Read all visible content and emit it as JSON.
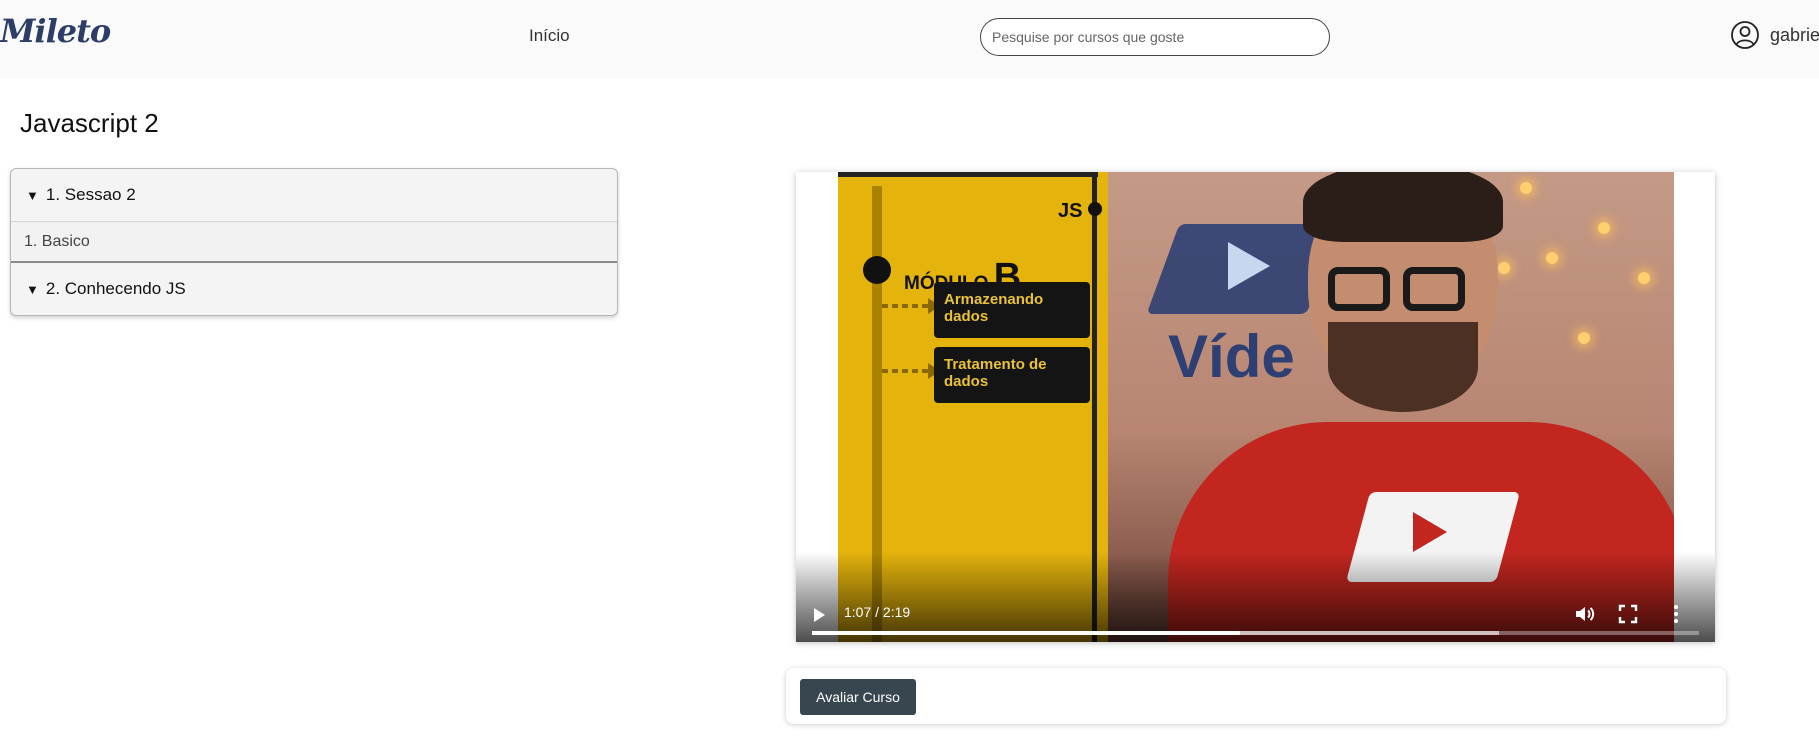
{
  "header": {
    "logo": "Mileto",
    "nav_inicio": "Início",
    "search_placeholder": "Pesquise por cursos que goste",
    "username": "gabriel",
    "user_icon": "user-circle-icon"
  },
  "course": {
    "title": "Javascript 2",
    "sections": [
      {
        "label": "1. Sessao 2",
        "lessons": [
          "1. Basico"
        ]
      },
      {
        "label": "2. Conhecendo JS",
        "lessons": []
      }
    ]
  },
  "video": {
    "slide_js": "JS",
    "slide_modulo": "MÓDULO",
    "slide_modulo_letter": "B",
    "slide_item_1": "Armazenando dados",
    "slide_item_2": "Tratamento de dados",
    "wall_text": "Víde",
    "time_display": "1:07 / 2:19",
    "progress_fraction": 0.482,
    "buffered_fraction": 0.775
  },
  "actions": {
    "rate_course_label": "Avaliar Curso"
  },
  "colors": {
    "header_bg": "#fafafa",
    "logo": "#2c3e66",
    "button_bg": "#38474f",
    "slide_yellow": "#e4b30c"
  }
}
